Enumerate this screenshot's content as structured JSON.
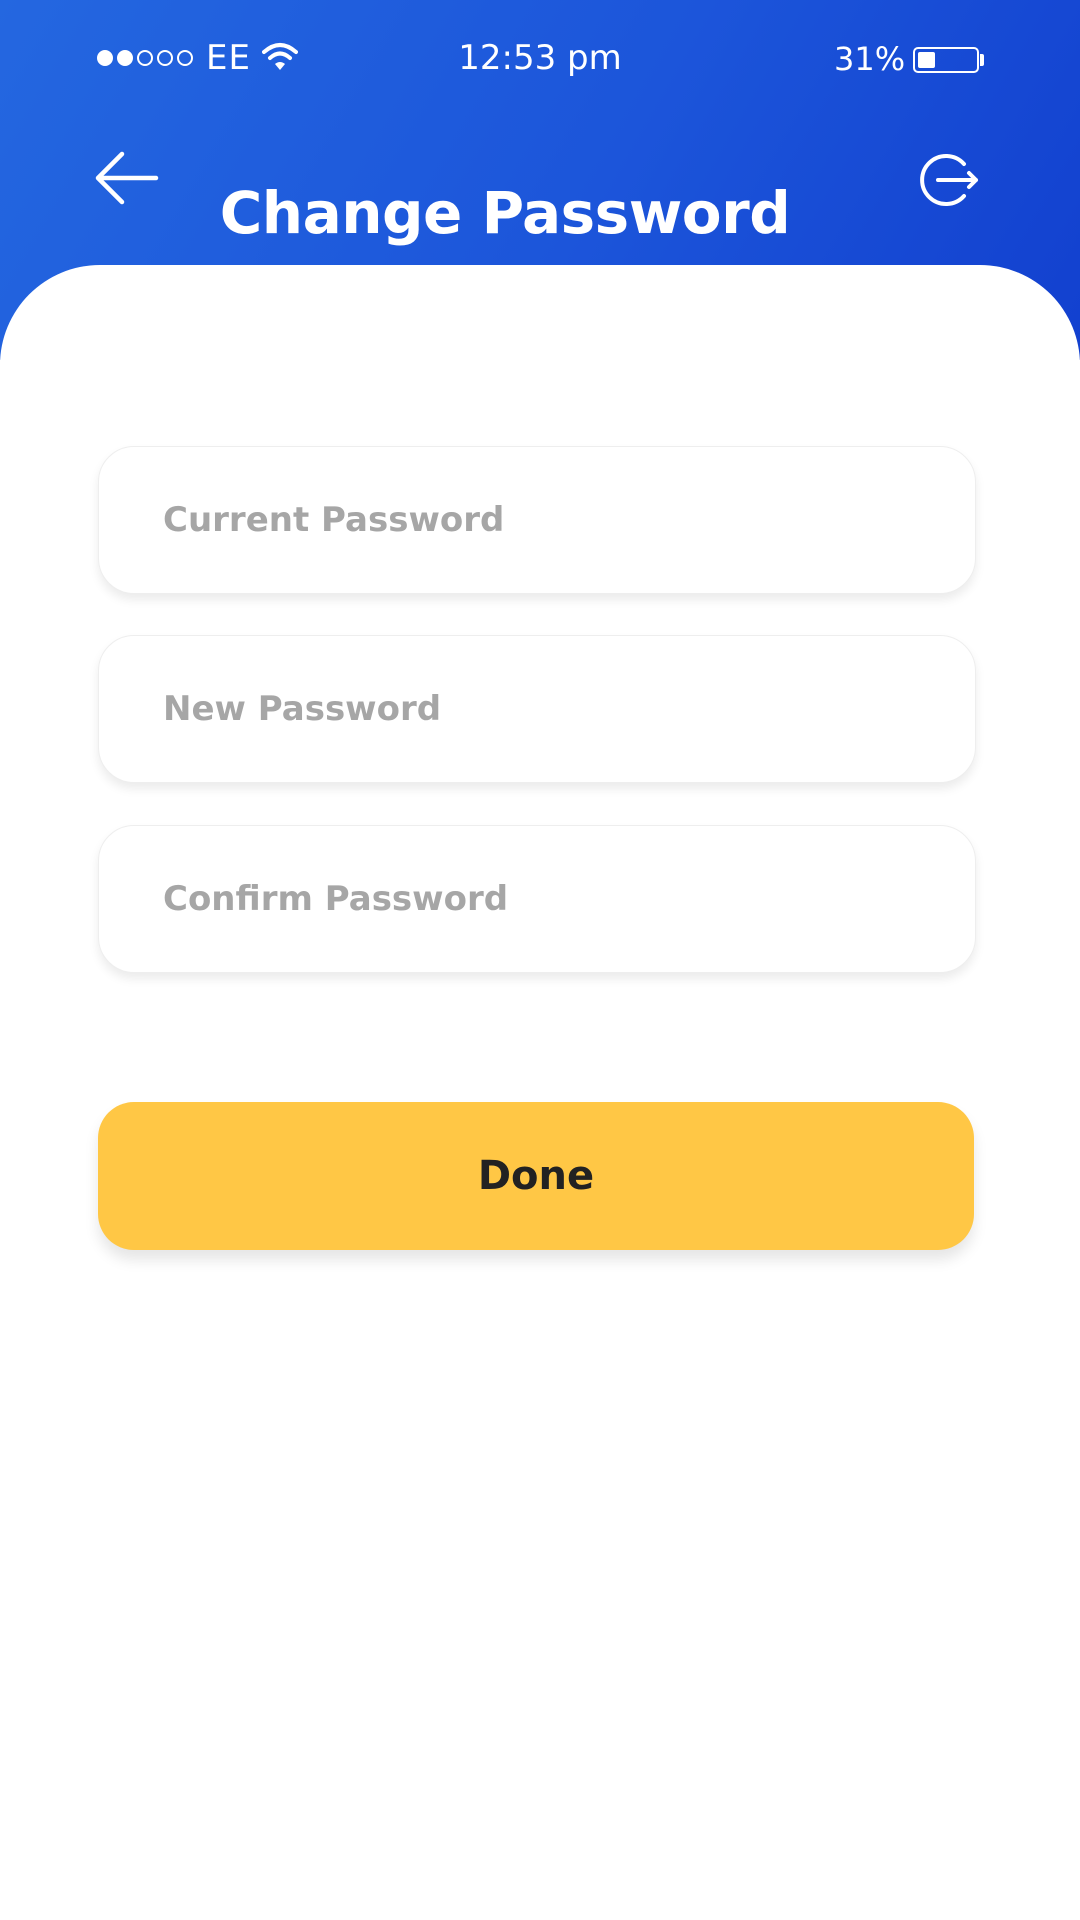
{
  "colors": {
    "header_gradient_start": "#2467e0",
    "header_gradient_end": "#1240cf",
    "accent": "#ffc745",
    "placeholder_text": "#a6a6a6",
    "button_text": "#222222"
  },
  "status_bar": {
    "signal_strength": 2,
    "signal_total": 5,
    "carrier": "EE",
    "wifi_icon": "wifi-icon",
    "time": "12:53 pm",
    "battery_percent": "31%",
    "battery_level": 0.31
  },
  "header": {
    "back_icon": "arrow-left-icon",
    "title": "Change Password",
    "logout_icon": "logout-icon"
  },
  "form": {
    "current_password": {
      "value": "",
      "placeholder": "Current Password"
    },
    "new_password": {
      "value": "",
      "placeholder": "New Password"
    },
    "confirm_password": {
      "value": "",
      "placeholder": "Confirm Password"
    },
    "done_label": "Done"
  }
}
